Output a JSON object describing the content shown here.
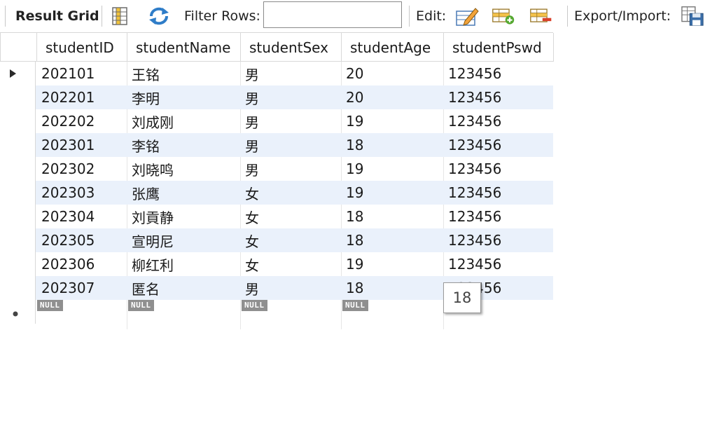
{
  "toolbar": {
    "result_grid_label": "Result Grid",
    "filter_rows_label": "Filter Rows:",
    "filter_value": "",
    "edit_label": "Edit:",
    "export_import_label": "Export/Import:",
    "icons": [
      "grid-layout-icon",
      "refresh-icon",
      "edit-pencil-icon",
      "add-row-icon",
      "delete-row-icon",
      "export-icon"
    ]
  },
  "grid": {
    "columns": [
      "studentID",
      "studentName",
      "studentSex",
      "studentAge",
      "studentPswd"
    ],
    "rows": [
      [
        "202101",
        "王铭",
        "男",
        "20",
        "123456"
      ],
      [
        "202201",
        "李明",
        "男",
        "20",
        "123456"
      ],
      [
        "202202",
        "刘成刚",
        "男",
        "19",
        "123456"
      ],
      [
        "202301",
        "李铭",
        "男",
        "18",
        "123456"
      ],
      [
        "202302",
        "刘晓鸣",
        "男",
        "19",
        "123456"
      ],
      [
        "202303",
        "张鹰",
        "女",
        "19",
        "123456"
      ],
      [
        "202304",
        "刘貢静",
        "女",
        "18",
        "123456"
      ],
      [
        "202305",
        "宣明尼",
        "女",
        "18",
        "123456"
      ],
      [
        "202306",
        "柳红利",
        "女",
        "19",
        "123456"
      ],
      [
        "202307",
        "匿名",
        "男",
        "18",
        "123456"
      ]
    ],
    "new_row_null_label": "NULL",
    "tooltip_value": "18",
    "alt_row_color": "#eaf1fb"
  }
}
